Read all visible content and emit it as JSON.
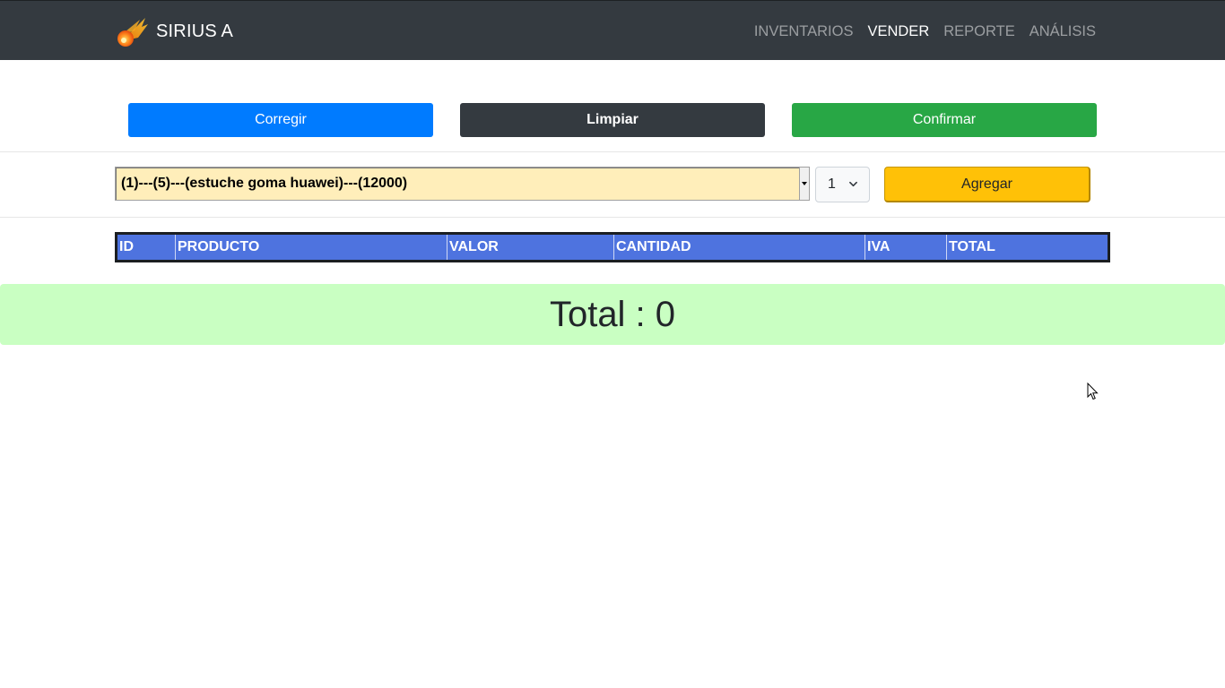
{
  "navbar": {
    "brand": "SIRIUS A",
    "brand_icon": "comet-icon",
    "links": [
      {
        "label": "INVENTARIOS",
        "active": false
      },
      {
        "label": "VENDER",
        "active": true
      },
      {
        "label": "REPORTE",
        "active": false
      },
      {
        "label": "ANÁLISIS",
        "active": false
      }
    ]
  },
  "actions": {
    "corregir": "Corregir",
    "limpiar": "Limpiar",
    "confirmar": "Confirmar"
  },
  "form": {
    "product_selected": "(1)---(5)---(estuche goma huawei)---(12000)",
    "quantity_selected": "1",
    "add_label": "Agregar"
  },
  "table": {
    "headers": [
      "ID",
      "PRODUCTO",
      "VALOR",
      "CANTIDAD",
      "IVA",
      "TOTAL"
    ]
  },
  "summary": {
    "total_text": "Total : 0"
  },
  "colors": {
    "navbar": "#343a40",
    "primary": "#007bff",
    "dark": "#343a40",
    "success": "#28a745",
    "warning": "#ffc107",
    "select_bg": "#ffeeba",
    "table_header": "#4e73df",
    "total_bg": "#c9ffc2"
  }
}
